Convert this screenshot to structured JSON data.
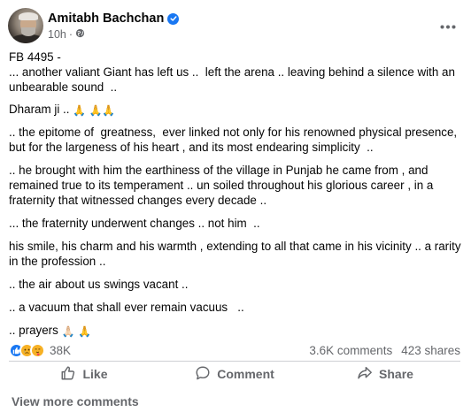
{
  "post": {
    "author": "Amitabh Bachchan",
    "time": "10h",
    "separator": "·",
    "paragraphs": [
      "FB 4495 -\n... another valiant Giant has left us ..  left the arena .. leaving behind a silence with an unbearable sound  ..",
      "Dharam ji .. ",
      ".. the epitome of  greatness,  ever linked not only for his renowned physical presence, but for the largeness of his heart , and its most endearing simplicity  ..",
      ".. he brought with him the earthiness of the village in Punjab he came from , and remained true to its temperament .. un soiled throughout his glorious career , in a fraternity that witnessed changes every decade ..",
      "... the fraternity underwent changes .. not him  ..",
      "his smile, his charm and his warmth , extending to all that came in his vicinity .. a rarity in the profession ..",
      ".. the air about us swings vacant ..",
      ".. a vacuum that shall ever remain vacuus   ..",
      ".. prayers "
    ],
    "dharam_emoji": "🙏 🙏🙏",
    "prayers_emoji": [
      "🙏🏻",
      "🙏"
    ]
  },
  "stats": {
    "reaction_count": "38K",
    "comments": "3.6K comments",
    "shares": "423 shares"
  },
  "actions": {
    "like": "Like",
    "comment": "Comment",
    "share": "Share"
  },
  "footer": {
    "view_more": "View more comments"
  },
  "icons": {
    "verified": "verified-badge-icon",
    "audience": "public-globe-icon",
    "more": "more-options-icon",
    "like": "thumbs-up-icon",
    "comment": "speech-bubble-icon",
    "share": "share-arrow-icon"
  },
  "colors": {
    "accent": "#1877f2",
    "secondary_text": "#65676b",
    "divider": "#ced0d4"
  }
}
